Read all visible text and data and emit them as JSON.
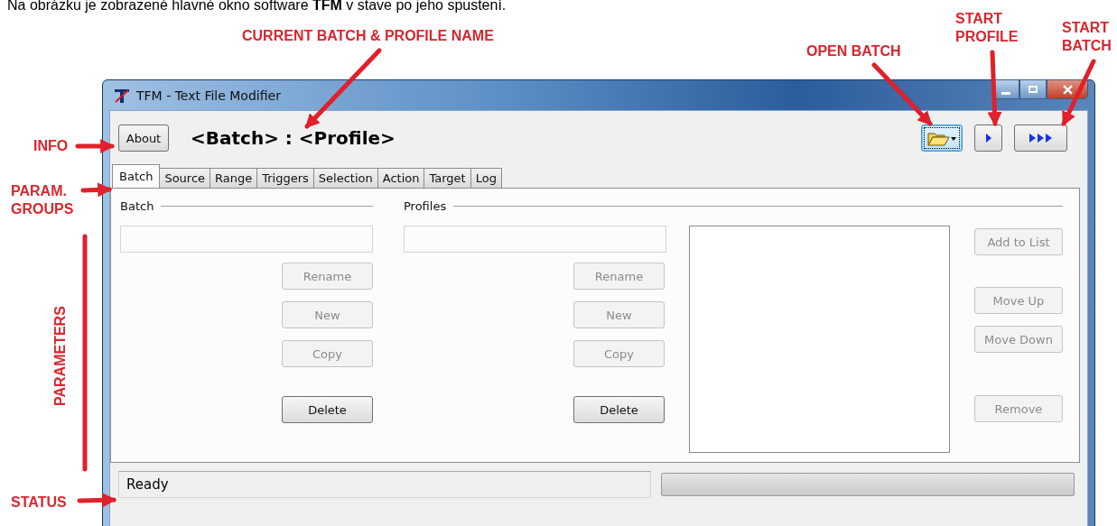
{
  "document_text": "Na obrázku je zobrazené hlavné okno software **TFM** v stave po jeho spustení.",
  "annotations": [
    {
      "text": "CURRENT BATCH & PROFILE NAME",
      "kind": "arrow"
    },
    {
      "text": "OPEN BATCH",
      "kind": "arrow"
    },
    {
      "text": "START PROFILE",
      "kind": "arrow"
    },
    {
      "text": "START BATCH",
      "kind": "arrow"
    },
    {
      "text": "INFO",
      "kind": "arrow"
    },
    {
      "text": "PARAM. GROUPS",
      "kind": "arrow"
    },
    {
      "text": "PARAMETERS",
      "kind": "bar"
    },
    {
      "text": "STATUS",
      "kind": "arrow"
    }
  ],
  "window": {
    "title": "TFM - Text File Modifier",
    "about_button": "About",
    "current_name": "<Batch> : <Profile>",
    "toolbar": [
      {
        "kind": "open",
        "focused": true
      },
      {
        "kind": "start_profile",
        "focused": false
      },
      {
        "kind": "start_batch",
        "focused": false
      }
    ],
    "tabs": [
      {
        "label": "Batch",
        "selected": true
      },
      {
        "label": "Source",
        "selected": false
      },
      {
        "label": "Range",
        "selected": false
      },
      {
        "label": "Triggers",
        "selected": false
      },
      {
        "label": "Selection",
        "selected": false
      },
      {
        "label": "Action",
        "selected": false
      },
      {
        "label": "Target",
        "selected": false
      },
      {
        "label": "Log",
        "selected": false
      }
    ],
    "batch_group": {
      "label": "Batch",
      "buttons": [
        {
          "label": "Rename",
          "disabled": true
        },
        {
          "label": "New",
          "disabled": true
        },
        {
          "label": "Copy",
          "disabled": true
        },
        {
          "label": "Delete",
          "disabled": false
        }
      ]
    },
    "profiles_group": {
      "label": "Profiles",
      "buttons": [
        {
          "label": "Rename",
          "disabled": true
        },
        {
          "label": "New",
          "disabled": true
        },
        {
          "label": "Copy",
          "disabled": true
        },
        {
          "label": "Delete",
          "disabled": false
        }
      ],
      "list_buttons": [
        {
          "label": "Add to List",
          "disabled": true
        },
        {
          "label": "Move Up",
          "disabled": true
        },
        {
          "label": "Move Down",
          "disabled": true
        },
        {
          "label": "Remove",
          "disabled": true
        }
      ]
    },
    "status_bar": {
      "text": "Ready",
      "progress": {
        "level": 0
      }
    }
  }
}
